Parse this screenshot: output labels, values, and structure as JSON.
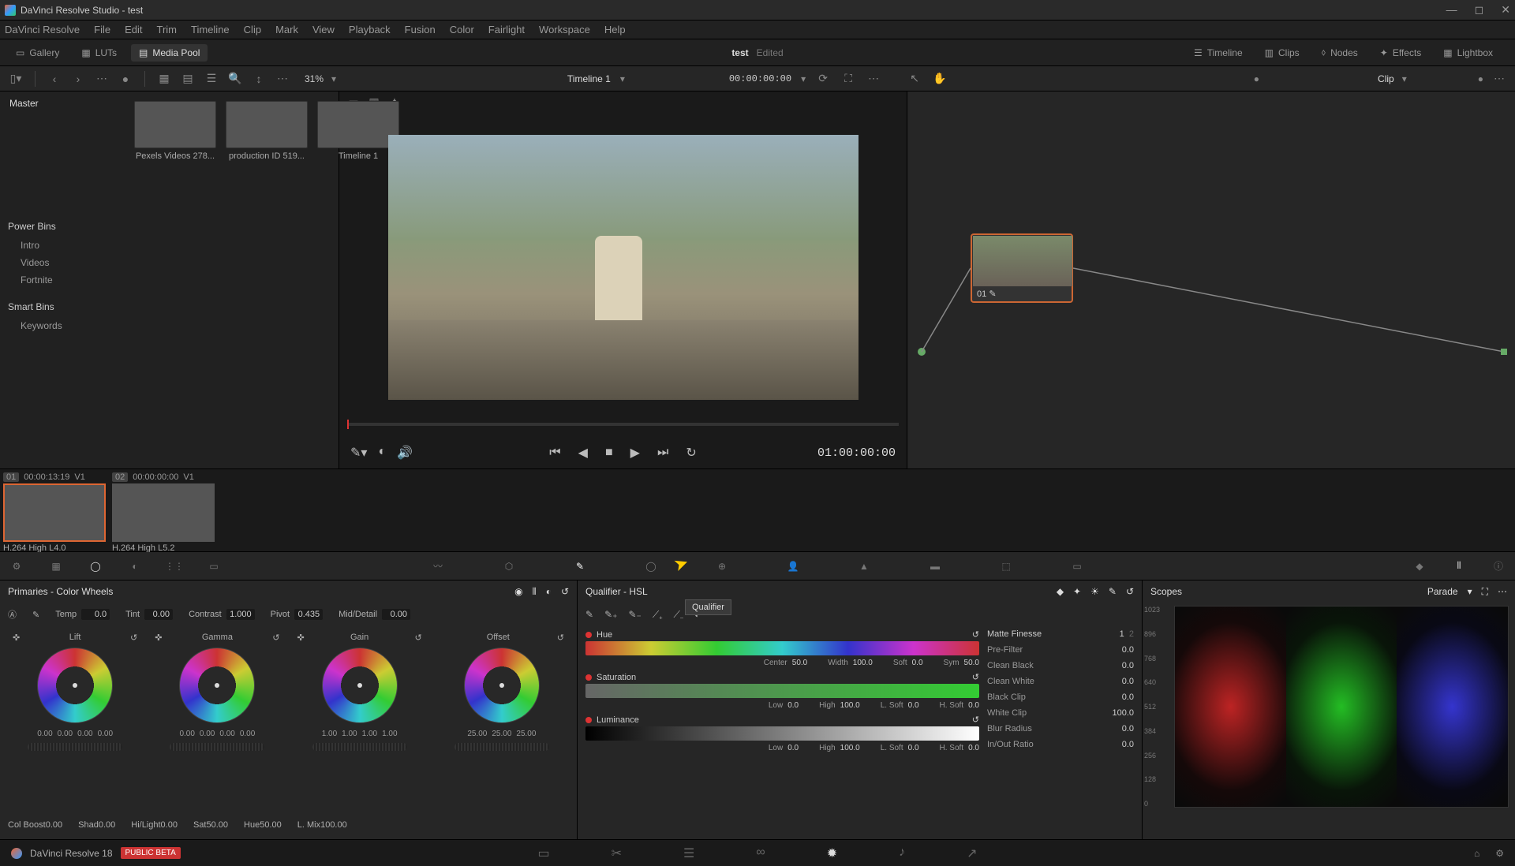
{
  "titlebar": {
    "title": "DaVinci Resolve Studio - test"
  },
  "menu": [
    "DaVinci Resolve",
    "File",
    "Edit",
    "Trim",
    "Timeline",
    "Clip",
    "Mark",
    "View",
    "Playback",
    "Fusion",
    "Color",
    "Fairlight",
    "Workspace",
    "Help"
  ],
  "toolbar1": {
    "gallery": "Gallery",
    "luts": "LUTs",
    "mediapool": "Media Pool",
    "projtitle": "test",
    "edited": "Edited",
    "timeline": "Timeline",
    "clips": "Clips",
    "nodes": "Nodes",
    "effects": "Effects",
    "lightbox": "Lightbox"
  },
  "toolbar2": {
    "zoom": "31%",
    "timeline_name": "Timeline 1",
    "tc": "00:00:00:00",
    "clip_label": "Clip"
  },
  "media": {
    "master": "Master",
    "clips": [
      {
        "label": "Pexels Videos 278...",
        "cls": "t1"
      },
      {
        "label": "production ID 519...",
        "cls": "t2"
      },
      {
        "label": "Timeline 1",
        "cls": "t3"
      }
    ],
    "powerbins": "Power Bins",
    "pb_items": [
      "Intro",
      "Videos",
      "Fortnite"
    ],
    "smartbins": "Smart Bins",
    "sb_items": [
      "Keywords"
    ]
  },
  "viewer": {
    "tc": "01:00:00:00"
  },
  "node": {
    "label": "01"
  },
  "strip": [
    {
      "n": "01",
      "tc": "00:00:13:19",
      "track": "V1",
      "codec": "H.264 High L4.0",
      "sel": true,
      "cls": "t2"
    },
    {
      "n": "02",
      "tc": "00:00:00:00",
      "track": "V1",
      "codec": "H.264 High L5.2",
      "sel": false,
      "cls": "t1"
    }
  ],
  "primaries": {
    "title": "Primaries - Color Wheels",
    "row1": {
      "temp": "Temp",
      "temp_v": "0.0",
      "tint": "Tint",
      "tint_v": "0.00",
      "contrast": "Contrast",
      "contrast_v": "1.000",
      "pivot": "Pivot",
      "pivot_v": "0.435",
      "md": "Mid/Detail",
      "md_v": "0.00"
    },
    "wheels": [
      {
        "name": "Lift",
        "vals": [
          "0.00",
          "0.00",
          "0.00",
          "0.00"
        ]
      },
      {
        "name": "Gamma",
        "vals": [
          "0.00",
          "0.00",
          "0.00",
          "0.00"
        ]
      },
      {
        "name": "Gain",
        "vals": [
          "1.00",
          "1.00",
          "1.00",
          "1.00"
        ]
      },
      {
        "name": "Offset",
        "vals": [
          "25.00",
          "25.00",
          "25.00"
        ]
      }
    ],
    "row2": {
      "cb": "Col Boost",
      "cb_v": "0.00",
      "shad": "Shad",
      "shad_v": "0.00",
      "hl": "Hi/Light",
      "hl_v": "0.00",
      "sat": "Sat",
      "sat_v": "50.00",
      "hue": "Hue",
      "hue_v": "50.00",
      "lmix": "L. Mix",
      "lmix_v": "100.00"
    }
  },
  "qualifier": {
    "title": "Qualifier - HSL",
    "tooltip": "Qualifier",
    "hue": {
      "label": "Hue",
      "center": "Center",
      "center_v": "50.0",
      "width": "Width",
      "width_v": "100.0",
      "soft": "Soft",
      "soft_v": "0.0",
      "sym": "Sym",
      "sym_v": "50.0"
    },
    "sat": {
      "label": "Saturation",
      "low": "Low",
      "low_v": "0.0",
      "high": "High",
      "high_v": "100.0",
      "lsoft": "L. Soft",
      "lsoft_v": "0.0",
      "hsoft": "H. Soft",
      "hsoft_v": "0.0"
    },
    "lum": {
      "label": "Luminance",
      "low": "Low",
      "low_v": "0.0",
      "high": "High",
      "high_v": "100.0",
      "lsoft": "L. Soft",
      "lsoft_v": "0.0",
      "hsoft": "H. Soft",
      "hsoft_v": "0.0"
    },
    "mf": {
      "title": "Matte Finesse",
      "page1": "1",
      "page2": "2",
      "rows": [
        {
          "l": "Pre-Filter",
          "v": "0.0"
        },
        {
          "l": "Clean Black",
          "v": "0.0"
        },
        {
          "l": "Clean White",
          "v": "0.0"
        },
        {
          "l": "Black Clip",
          "v": "0.0"
        },
        {
          "l": "White Clip",
          "v": "100.0"
        },
        {
          "l": "Blur Radius",
          "v": "0.0"
        },
        {
          "l": "In/Out Ratio",
          "v": "0.0"
        }
      ]
    }
  },
  "scopes": {
    "title": "Scopes",
    "mode": "Parade",
    "yaxis": [
      "1023",
      "896",
      "768",
      "640",
      "512",
      "384",
      "256",
      "128",
      "0"
    ]
  },
  "bottom": {
    "version": "DaVinci Resolve 18",
    "beta": "PUBLIC BETA"
  }
}
